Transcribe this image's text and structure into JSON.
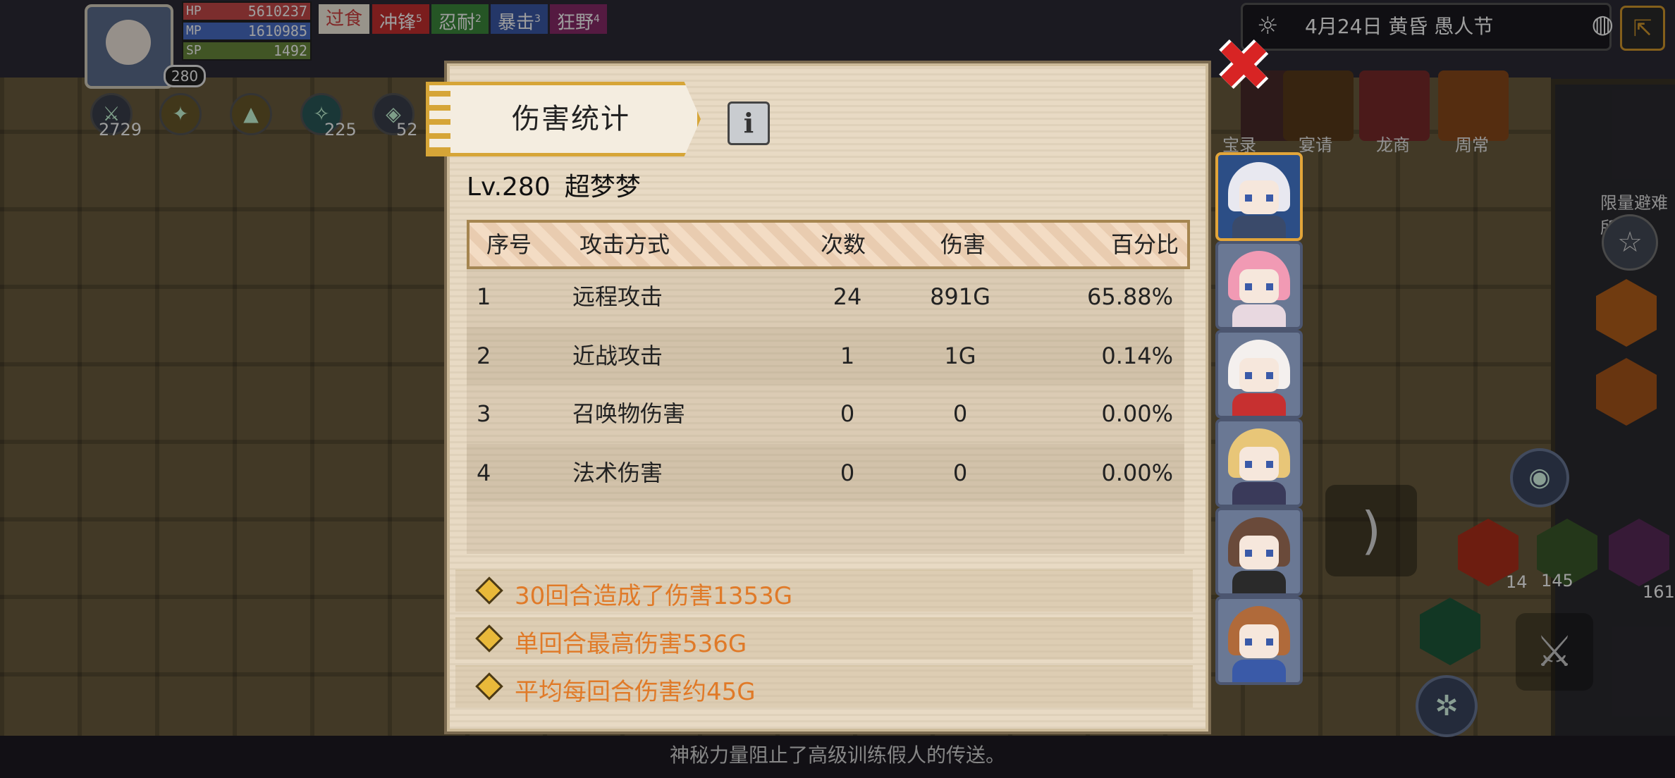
{
  "hud": {
    "level": "280",
    "hp_label": "HP",
    "hp_value": "5610237",
    "mp_label": "MP",
    "mp_value": "1610985",
    "sp_label": "SP",
    "sp_value": "1492",
    "buffs": [
      {
        "label": "过食",
        "count": ""
      },
      {
        "label": "冲锋",
        "count": "5"
      },
      {
        "label": "忍耐",
        "count": "2"
      },
      {
        "label": "暴击",
        "count": "3"
      },
      {
        "label": "狂野",
        "count": "4"
      }
    ],
    "skill_counts": [
      "2729",
      "225",
      "52"
    ]
  },
  "topbar": {
    "date_text": "4月24日  黄昏  愚人节",
    "icons": [
      "sun-icon",
      "globe-icon",
      "exit-icon"
    ]
  },
  "shop_bar": {
    "labels": [
      "宝录",
      "宴请",
      "龙商",
      "周常"
    ]
  },
  "side_panel": {
    "label": "限量避难所",
    "item_counts": [
      "14",
      "145",
      "161"
    ]
  },
  "message": "神秘力量阻止了高级训练假人的传送。",
  "modal": {
    "title": "伤害统计",
    "info_label": "i",
    "close_label": "✖",
    "level_text": "Lv.280",
    "character_name": "超梦梦",
    "table": {
      "headers": [
        "序号",
        "攻击方式",
        "次数",
        "伤害",
        "百分比"
      ],
      "rows": [
        {
          "idx": "1",
          "type": "远程攻击",
          "count": "24",
          "damage": "891G",
          "percent": "65.88%"
        },
        {
          "idx": "2",
          "type": "近战攻击",
          "count": "1",
          "damage": "1G",
          "percent": "0.14%"
        },
        {
          "idx": "3",
          "type": "召唤物伤害",
          "count": "0",
          "damage": "0",
          "percent": "0.00%"
        },
        {
          "idx": "4",
          "type": "法术伤害",
          "count": "0",
          "damage": "0",
          "percent": "0.00%"
        }
      ]
    },
    "summary": [
      "30回合造成了伤害1353G",
      "单回合最高伤害536G",
      "平均每回合伤害约45G"
    ]
  },
  "colors": {
    "accent_orange": "#e07a28",
    "tab_gold": "#d6a537",
    "close_red": "#d82424",
    "selected_border": "#e2a53a"
  },
  "character_list": [
    {
      "name": "character-1",
      "selected": true,
      "hair": "#e8e8f0",
      "body": "#3a4a6a"
    },
    {
      "name": "character-2",
      "selected": false,
      "hair": "#f19ab4",
      "body": "#e8d8e0"
    },
    {
      "name": "character-3",
      "selected": false,
      "hair": "#f4f0ee",
      "body": "#c73030"
    },
    {
      "name": "character-4",
      "selected": false,
      "hair": "#e8c678",
      "body": "#3a3a5a"
    },
    {
      "name": "character-5",
      "selected": false,
      "hair": "#6a4a3a",
      "body": "#2a2a2a"
    },
    {
      "name": "character-6",
      "selected": false,
      "hair": "#b06a3a",
      "body": "#3a5aa8"
    }
  ]
}
